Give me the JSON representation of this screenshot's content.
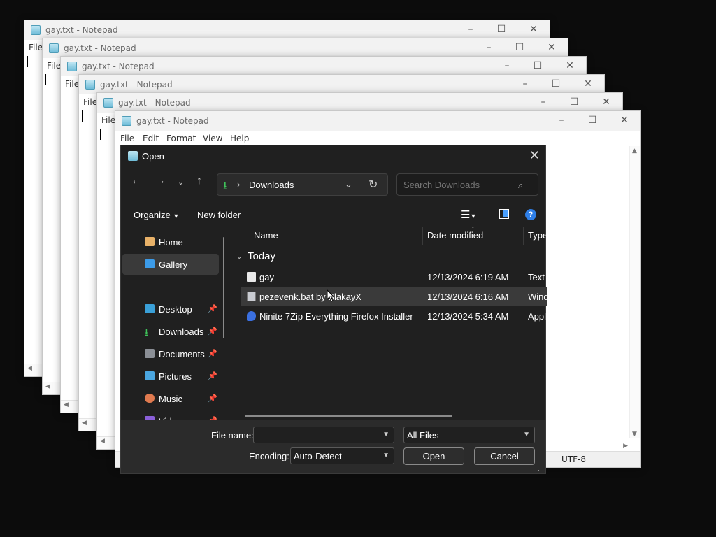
{
  "notepad": {
    "title": "gay.txt - Notepad",
    "menu": [
      "File",
      "Edit",
      "Format",
      "View",
      "Help"
    ],
    "encoding": "UTF-8"
  },
  "dialog": {
    "title": "Open",
    "breadcrumb": "Downloads",
    "search_placeholder": "Search Downloads",
    "organize_label": "Organize",
    "new_folder_label": "New folder",
    "sidebar": [
      {
        "label": "Home",
        "icon": "home-icon"
      },
      {
        "label": "Gallery",
        "icon": "gallery-icon"
      },
      {
        "label": "Desktop",
        "icon": "desktop-icon"
      },
      {
        "label": "Downloads",
        "icon": "downloads-icon"
      },
      {
        "label": "Documents",
        "icon": "documents-icon"
      },
      {
        "label": "Pictures",
        "icon": "pictures-icon"
      },
      {
        "label": "Music",
        "icon": "music-icon"
      },
      {
        "label": "Videos",
        "icon": "videos-icon"
      }
    ],
    "columns": {
      "name": "Name",
      "date": "Date modified",
      "type": "Type"
    },
    "group_label": "Today",
    "files": [
      {
        "name": "gay",
        "date": "12/13/2024 6:19 AM",
        "type": "Text D"
      },
      {
        "name": "pezevenk.bat by BlakayX",
        "date": "12/13/2024 6:16 AM",
        "type": "Wind"
      },
      {
        "name": "Ninite 7Zip Everything Firefox Installer",
        "date": "12/13/2024 5:34 AM",
        "type": "Appli"
      }
    ],
    "file_name_label": "File name:",
    "file_name_value": "",
    "filter_value": "All Files",
    "encoding_label": "Encoding:",
    "encoding_value": "Auto-Detect",
    "open_label": "Open",
    "cancel_label": "Cancel"
  },
  "colors": {
    "accent": "#3fc35a",
    "dialog_bg": "#202020",
    "selection": "#3a3a3a"
  }
}
